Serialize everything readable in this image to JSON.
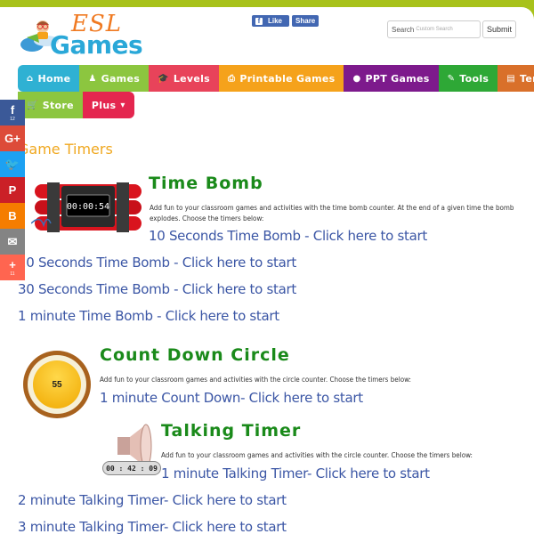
{
  "header": {
    "logo_top": "ESL",
    "logo_bottom": "Games",
    "fb_like": "Like",
    "fb_share": "Share",
    "search_label": "Search",
    "search_placeholder": "Custom Search",
    "submit_label": "Submit"
  },
  "nav": {
    "items": [
      {
        "label": "Home",
        "icon": "home-icon",
        "glyph": "⌂",
        "color": "#2fb1d3"
      },
      {
        "label": "Games",
        "icon": "chess-pawn-icon",
        "glyph": "♟",
        "color": "#8cc63f"
      },
      {
        "label": "Levels",
        "icon": "graduation-cap-icon",
        "glyph": "🎓",
        "color": "#e8435a"
      },
      {
        "label": "Printable Games",
        "icon": "printer-icon",
        "glyph": "⎙",
        "color": "#f5a21b"
      },
      {
        "label": "PPT Games",
        "icon": "apple-icon",
        "glyph": "●",
        "color": "#7d1a8c"
      },
      {
        "label": "Tools",
        "icon": "wrench-icon",
        "glyph": "✎",
        "color": "#2ea836"
      },
      {
        "label": "Templates",
        "icon": "list-alt-icon",
        "glyph": "▤",
        "color": "#d9702a"
      },
      {
        "label": "Store",
        "icon": "cart-icon",
        "glyph": "🛒",
        "color": "#8cc63f"
      },
      {
        "label": "Plus",
        "icon": "caret-down-icon",
        "glyph": "▾",
        "color": "#e4264f"
      }
    ]
  },
  "share": [
    {
      "name": "facebook",
      "glyph": "f",
      "count": "12",
      "color": "#3b5998"
    },
    {
      "name": "google-plus",
      "glyph": "G+",
      "count": "",
      "color": "#dd4b39"
    },
    {
      "name": "twitter",
      "glyph": "🐦",
      "count": "",
      "color": "#1da1f2"
    },
    {
      "name": "pinterest",
      "glyph": "P",
      "count": "",
      "color": "#cb2027"
    },
    {
      "name": "blogger",
      "glyph": "B",
      "count": "",
      "color": "#f57d00"
    },
    {
      "name": "email",
      "glyph": "✉",
      "count": "",
      "color": "#848484"
    },
    {
      "name": "more",
      "glyph": "+",
      "count": "11",
      "color": "#ff6550"
    }
  ],
  "content": {
    "section_title": "Game Timers",
    "time_bomb": {
      "title": "Time Bomb",
      "description": "Add fun to your classroom games and activities with the time bomb counter. At the end of a given time the bomb explodes. Choose the timers below:",
      "display": "00:00:54",
      "links": [
        "10 Seconds Time Bomb - Click here to start",
        "20 Seconds Time Bomb - Click here to start",
        "30 Seconds Time Bomb - Click here to start",
        "1 minute Time Bomb - Click here to start"
      ]
    },
    "count_down": {
      "title": "Count Down Circle",
      "description": "Add fun to your classroom games and activities with the circle counter. Choose the timers below:",
      "display": "55",
      "links": [
        "1 minute Count Down- Click here to start"
      ]
    },
    "talking_timer": {
      "title": "Talking Timer",
      "description": "Add fun to your classroom games and activities with the circle counter. Choose the timers below:",
      "display": "00 : 42 : 09",
      "links": [
        "1 minute Talking Timer- Click here to start",
        "2 minute Talking Timer- Click here to start",
        "3 minute Talking Timer- Click here to start"
      ]
    }
  }
}
